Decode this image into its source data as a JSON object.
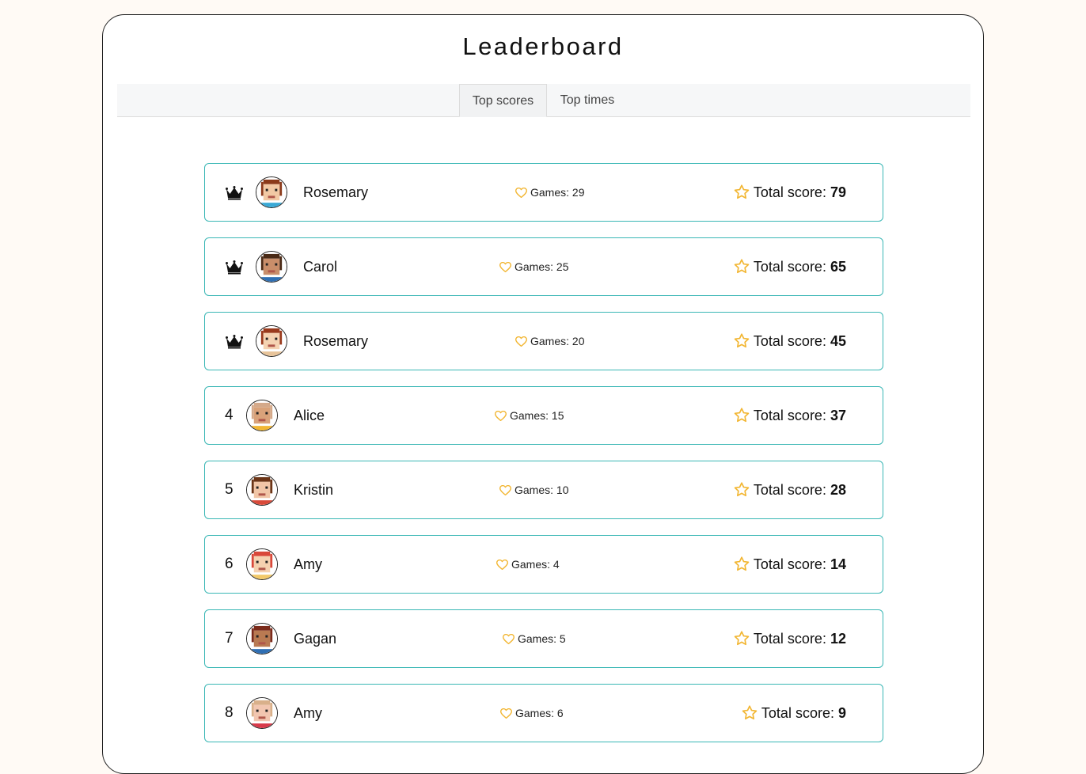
{
  "title": "Leaderboard",
  "tabs": [
    {
      "label": "Top scores",
      "active": true
    },
    {
      "label": "Top times",
      "active": false
    }
  ],
  "entries": [
    {
      "rank": "1",
      "crown": true,
      "name": "Rosemary",
      "games_label": "Games: 29",
      "score_label": "Total score:",
      "score": "79",
      "avatar": {
        "skin": "#f2c9a4",
        "hair": "#8b3a1a",
        "shirt": "#3aa9d6"
      }
    },
    {
      "rank": "2",
      "crown": true,
      "name": "Carol",
      "games_label": "Games: 25",
      "score_label": "Total score:",
      "score": "65",
      "avatar": {
        "skin": "#c98e6a",
        "hair": "#4a2a16",
        "shirt": "#2f6fb3"
      }
    },
    {
      "rank": "3",
      "crown": true,
      "name": "Rosemary",
      "games_label": "Games: 20",
      "score_label": "Total score:",
      "score": "45",
      "avatar": {
        "skin": "#f5d3b2",
        "hair": "#9a3a1c",
        "shirt": "#e8c49a"
      }
    },
    {
      "rank": "4",
      "crown": false,
      "name": "Alice",
      "games_label": "Games: 15",
      "score_label": "Total score:",
      "score": "37",
      "avatar": {
        "skin": "#d9a27a",
        "hair": "#d4a98a",
        "shirt": "#f2b632"
      }
    },
    {
      "rank": "5",
      "crown": false,
      "name": "Kristin",
      "games_label": "Games: 10",
      "score_label": "Total score:",
      "score": "28",
      "avatar": {
        "skin": "#f1c6a7",
        "hair": "#6b3416",
        "shirt": "#d94a3a"
      }
    },
    {
      "rank": "6",
      "crown": false,
      "name": "Amy",
      "games_label": "Games: 4",
      "score_label": "Total score:",
      "score": "14",
      "avatar": {
        "skin": "#f5d1b0",
        "hair": "#d9483a",
        "shirt": "#f2c96a"
      }
    },
    {
      "rank": "7",
      "crown": false,
      "name": "Gagan",
      "games_label": "Games: 5",
      "score_label": "Total score:",
      "score": "12",
      "avatar": {
        "skin": "#b97a52",
        "hair": "#7a2a1a",
        "shirt": "#2f6fb3"
      }
    },
    {
      "rank": "8",
      "crown": false,
      "name": "Amy",
      "games_label": "Games: 6",
      "score_label": "Total score:",
      "score": "9",
      "avatar": {
        "skin": "#f2c6b0",
        "hair": "#d9b08a",
        "shirt": "#d93a4a"
      }
    }
  ],
  "icons": {
    "crown": "crown-icon",
    "games": "heart-icon",
    "score": "star-icon"
  },
  "colors": {
    "row_border": "#3ab7b5",
    "icon_accent": "#f2b632",
    "page_background": "#fffaf5"
  }
}
